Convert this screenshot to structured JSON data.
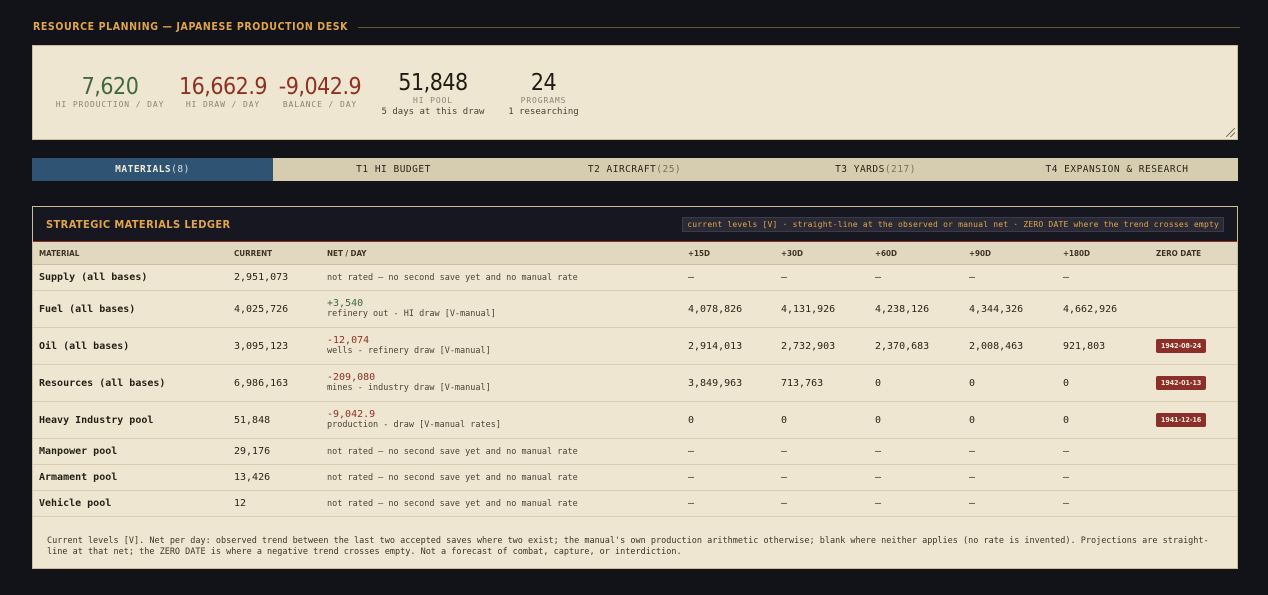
{
  "section_title": "RESOURCE PLANNING — JAPANESE PRODUCTION DESK",
  "kpis": [
    {
      "value": "7,620",
      "label": "HI PRODUCTION / DAY",
      "sub": ""
    },
    {
      "value": "16,662.9",
      "label": "HI DRAW / DAY",
      "sub": ""
    },
    {
      "value": "-9,042.9",
      "label": "BALANCE / DAY",
      "sub": ""
    },
    {
      "value": "51,848",
      "label": "HI POOL",
      "sub": "5 days at this draw"
    },
    {
      "value": "24",
      "label": "PROGRAMS",
      "sub": "1 researching"
    }
  ],
  "tabs": [
    {
      "label": "MATERIALS",
      "count": "(8)"
    },
    {
      "label": "T1 HI BUDGET",
      "count": ""
    },
    {
      "label": "T2 AIRCRAFT",
      "count": "(25)"
    },
    {
      "label": "T3 YARDS",
      "count": "(217)"
    },
    {
      "label": "T4 EXPANSION & RESEARCH",
      "count": ""
    }
  ],
  "ledger": {
    "title": "STRATEGIC MATERIALS LEDGER",
    "note": "current levels [V] · straight-line at the observed or manual net · ZERO DATE where the trend crosses empty",
    "columns": [
      "MATERIAL",
      "CURRENT",
      "NET / DAY",
      "+15D",
      "+30D",
      "+60D",
      "+90D",
      "+180D",
      "ZERO DATE"
    ],
    "rows": [
      {
        "material": "Supply (all bases)",
        "current": "2,951,073",
        "net": "",
        "net_note": "not rated — no second save yet and no manual rate",
        "p15": "—",
        "p30": "—",
        "p60": "—",
        "p90": "—",
        "p180": "—",
        "zero": ""
      },
      {
        "material": "Fuel (all bases)",
        "current": "4,025,726",
        "net": "+3,540",
        "net_note": "refinery out - HI draw [V-manual]",
        "p15": "4,078,826",
        "p30": "4,131,926",
        "p60": "4,238,126",
        "p90": "4,344,326",
        "p180": "4,662,926",
        "zero": ""
      },
      {
        "material": "Oil (all bases)",
        "current": "3,095,123",
        "net": "-12,074",
        "net_note": "wells - refinery draw [V-manual]",
        "p15": "2,914,013",
        "p30": "2,732,903",
        "p60": "2,370,683",
        "p90": "2,008,463",
        "p180": "921,803",
        "zero": "1942-08-24"
      },
      {
        "material": "Resources (all bases)",
        "current": "6,986,163",
        "net": "-209,080",
        "net_note": "mines - industry draw [V-manual]",
        "p15": "3,849,963",
        "p30": "713,763",
        "p60": "0",
        "p90": "0",
        "p180": "0",
        "zero": "1942-01-13"
      },
      {
        "material": "Heavy Industry pool",
        "current": "51,848",
        "net": "-9,042.9",
        "net_note": "production - draw [V-manual rates]",
        "p15": "0",
        "p30": "0",
        "p60": "0",
        "p90": "0",
        "p180": "0",
        "zero": "1941-12-16"
      },
      {
        "material": "Manpower pool",
        "current": "29,176",
        "net": "",
        "net_note": "not rated — no second save yet and no manual rate",
        "p15": "—",
        "p30": "—",
        "p60": "—",
        "p90": "—",
        "p180": "—",
        "zero": ""
      },
      {
        "material": "Armament pool",
        "current": "13,426",
        "net": "",
        "net_note": "not rated — no second save yet and no manual rate",
        "p15": "—",
        "p30": "—",
        "p60": "—",
        "p90": "—",
        "p180": "—",
        "zero": ""
      },
      {
        "material": "Vehicle pool",
        "current": "12",
        "net": "",
        "net_note": "not rated — no second save yet and no manual rate",
        "p15": "—",
        "p30": "—",
        "p60": "—",
        "p90": "—",
        "p180": "—",
        "zero": ""
      }
    ],
    "footnote": "Current levels [V]. Net per day: observed trend between the last two accepted saves where two exist; the manual's own production arithmetic otherwise; blank where neither applies (no rate is invented). Projections are straight-line at that net; the ZERO DATE is where a negative trend crosses empty. Not a forecast of combat, capture, or interdiction."
  },
  "colors": {
    "accent": "#e0a44a",
    "active_tab": "#2f5373",
    "positive": "#3f6a3c",
    "negative": "#8c3124",
    "panel": "#efe6d2",
    "background": "#121219"
  }
}
